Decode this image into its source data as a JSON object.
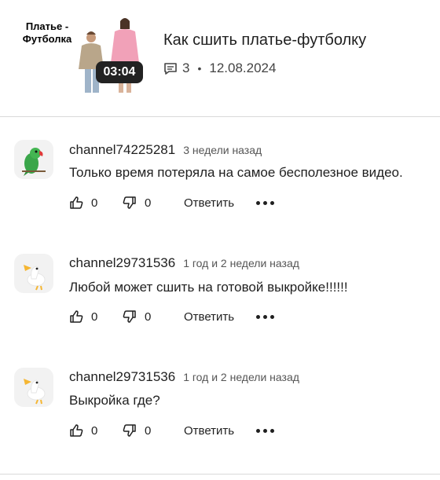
{
  "video": {
    "thumbnail_text": "Платье - Футболка",
    "duration": "03:04",
    "title": "Как сшить платье-футболку",
    "comment_count": "3",
    "date": "12.08.2024"
  },
  "comments": [
    {
      "author": "channel74225281",
      "time": "3 недели назад",
      "text": "Только время потеряла на самое бесполезное видео.",
      "likes": "0",
      "dislikes": "0",
      "reply_label": "Ответить",
      "avatar_icon": "parrot-icon"
    },
    {
      "author": "channel29731536",
      "time": "1 год и 2 недели назад",
      "text": "Любой может сшить на готовой выкройке!!!!!!",
      "likes": "0",
      "dislikes": "0",
      "reply_label": "Ответить",
      "avatar_icon": "goose-icon"
    },
    {
      "author": "channel29731536",
      "time": "1 год и 2 недели назад",
      "text": "Выкройка где?",
      "likes": "0",
      "dislikes": "0",
      "reply_label": "Ответить",
      "avatar_icon": "goose-icon"
    }
  ],
  "colors": {
    "text": "#1f1f1f",
    "muted": "#555555",
    "divider": "#d9d9d9",
    "badge": "#222222"
  }
}
